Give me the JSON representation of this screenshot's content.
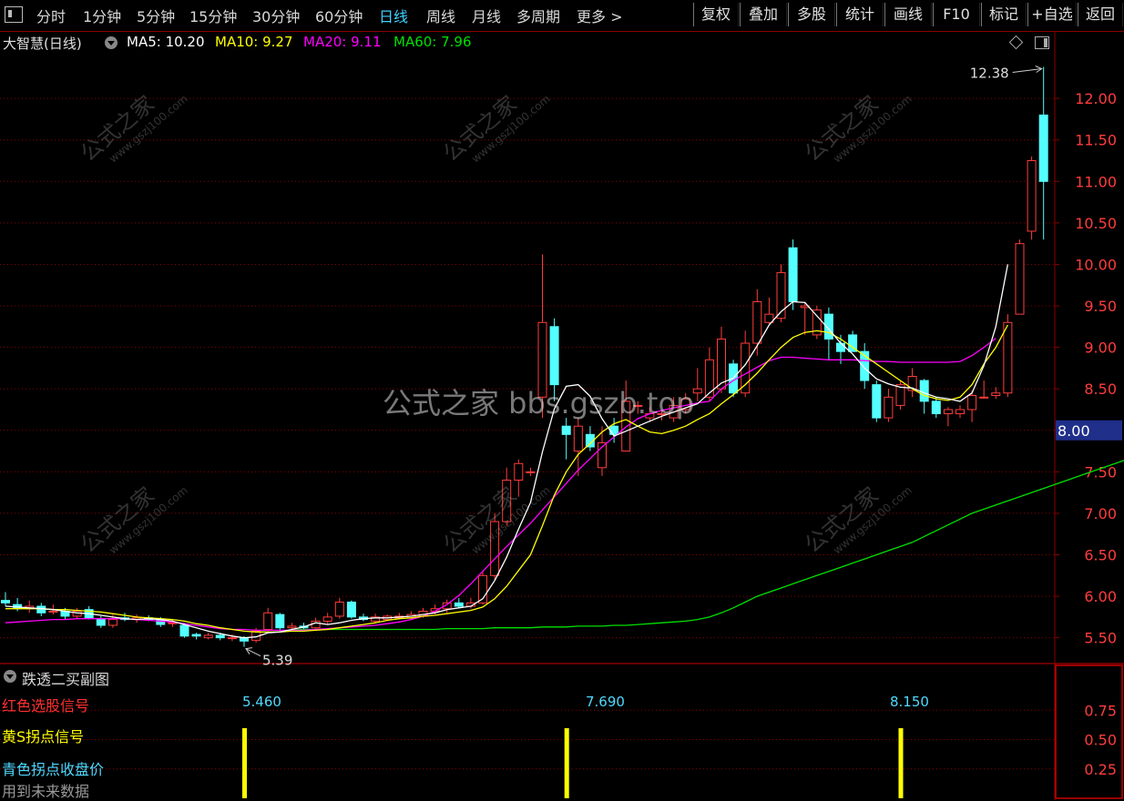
{
  "toolbar": {
    "tabs": [
      "分时",
      "1分钟",
      "5分钟",
      "15分钟",
      "30分钟",
      "60分钟",
      "日线",
      "周线",
      "月线",
      "多周期",
      "更多 >"
    ],
    "active_tab": "日线",
    "buttons": [
      "复权",
      "叠加",
      "多股",
      "统计",
      "画线",
      "F10",
      "标记",
      "+自选",
      "返回"
    ]
  },
  "header": {
    "stock_name": "大智慧(日线)",
    "ma5": "MA5: 10.20",
    "ma10": "MA10: 9.27",
    "ma20": "MA20: 9.11",
    "ma60": "MA60: 7.96"
  },
  "colors": {
    "up": "#ff3c3c",
    "down": "#54ffff",
    "ma5": "#ffffff",
    "ma10": "#ffff00",
    "ma20": "#ff00ff",
    "ma60": "#00e000",
    "grid": "#8b0000"
  },
  "annotations": {
    "high_label": "12.38",
    "low_label": "5.39",
    "current_price": "8.00"
  },
  "watermark": {
    "main": "公式之家 bbs.gszb.top",
    "diagonal": "公式之家",
    "diagonal_url": "www.gszj100.com"
  },
  "sub_panel": {
    "title": "跌透二买副图",
    "labels": [
      "红色选股信号",
      "黄S拐点信号",
      "青色拐点收盘价",
      "用到未来数据"
    ],
    "signal_values": [
      "5.460",
      "7.690",
      "8.150"
    ],
    "signal_prices": [
      5.46,
      7.69,
      8.15
    ]
  },
  "chart_data": [
    {
      "type": "candlestick",
      "title": "大智慧(日线)",
      "ylim": [
        5.2,
        12.55
      ],
      "y_ticks": [
        12.0,
        11.5,
        11.0,
        10.5,
        10.0,
        9.5,
        9.0,
        8.5,
        8.0,
        7.5,
        7.0,
        6.5,
        6.0,
        5.5
      ],
      "y_tick_labels": [
        "12.00",
        "11.50",
        "11.00",
        "10.50",
        "10.00",
        "9.50",
        "9.00",
        "8.50",
        "8.00",
        "7.50",
        "7.00",
        "6.50",
        "6.00",
        "5.50"
      ],
      "grid": true,
      "candles": [
        [
          5.95,
          5.92,
          6.05,
          5.88
        ],
        [
          5.9,
          5.85,
          5.98,
          5.82
        ],
        [
          5.85,
          5.88,
          5.95,
          5.8
        ],
        [
          5.88,
          5.8,
          5.92,
          5.76
        ],
        [
          5.82,
          5.82,
          5.9,
          5.78
        ],
        [
          5.82,
          5.76,
          5.86,
          5.72
        ],
        [
          5.76,
          5.82,
          5.86,
          5.73
        ],
        [
          5.84,
          5.74,
          5.88,
          5.72
        ],
        [
          5.72,
          5.65,
          5.76,
          5.62
        ],
        [
          5.65,
          5.72,
          5.78,
          5.62
        ],
        [
          5.74,
          5.72,
          5.8,
          5.7
        ],
        [
          5.72,
          5.74,
          5.78,
          5.68
        ],
        [
          5.74,
          5.72,
          5.77,
          5.7
        ],
        [
          5.72,
          5.66,
          5.75,
          5.63
        ],
        [
          5.68,
          5.68,
          5.72,
          5.63
        ],
        [
          5.65,
          5.52,
          5.68,
          5.5
        ],
        [
          5.54,
          5.52,
          5.56,
          5.48
        ],
        [
          5.5,
          5.53,
          5.56,
          5.48
        ],
        [
          5.53,
          5.5,
          5.56,
          5.47
        ],
        [
          5.5,
          5.5,
          5.54,
          5.46
        ],
        [
          5.5,
          5.46,
          5.52,
          5.39
        ],
        [
          5.47,
          5.58,
          5.62,
          5.44
        ],
        [
          5.6,
          5.8,
          5.86,
          5.58
        ],
        [
          5.78,
          5.62,
          5.8,
          5.58
        ],
        [
          5.62,
          5.64,
          5.68,
          5.58
        ],
        [
          5.64,
          5.62,
          5.68,
          5.6
        ],
        [
          5.62,
          5.7,
          5.74,
          5.6
        ],
        [
          5.7,
          5.75,
          5.8,
          5.66
        ],
        [
          5.76,
          5.93,
          5.98,
          5.73
        ],
        [
          5.93,
          5.75,
          5.95,
          5.73
        ],
        [
          5.75,
          5.72,
          5.79,
          5.7
        ],
        [
          5.7,
          5.75,
          5.79,
          5.68
        ],
        [
          5.72,
          5.76,
          5.78,
          5.7
        ],
        [
          5.74,
          5.76,
          5.8,
          5.72
        ],
        [
          5.74,
          5.78,
          5.82,
          5.72
        ],
        [
          5.76,
          5.82,
          5.86,
          5.74
        ],
        [
          5.82,
          5.85,
          5.9,
          5.78
        ],
        [
          5.85,
          5.92,
          5.96,
          5.8
        ],
        [
          5.92,
          5.88,
          5.98,
          5.86
        ],
        [
          5.88,
          5.92,
          5.98,
          5.85
        ],
        [
          5.92,
          6.25,
          6.3,
          5.9
        ],
        [
          6.25,
          6.9,
          7.0,
          6.2
        ],
        [
          6.9,
          7.4,
          7.55,
          6.85
        ],
        [
          7.4,
          7.6,
          7.65,
          7.2
        ],
        [
          7.5,
          7.5,
          7.55,
          7.45
        ],
        [
          8.4,
          9.3,
          10.12,
          8.15
        ],
        [
          9.25,
          8.55,
          9.35,
          8.35
        ],
        [
          8.05,
          7.95,
          8.15,
          7.65
        ],
        [
          7.75,
          8.05,
          8.15,
          7.45
        ],
        [
          7.95,
          7.8,
          8.05,
          7.75
        ],
        [
          7.55,
          7.85,
          8.05,
          7.45
        ],
        [
          8.05,
          7.95,
          8.15,
          7.85
        ],
        [
          7.75,
          8.35,
          8.6,
          7.75
        ],
        [
          8.3,
          8.3,
          8.35,
          8.2
        ],
        [
          8.15,
          8.2,
          8.28,
          8.1
        ],
        [
          8.2,
          8.2,
          8.24,
          8.12
        ],
        [
          8.15,
          8.3,
          8.4,
          8.1
        ],
        [
          8.25,
          8.38,
          8.45,
          8.2
        ],
        [
          8.45,
          8.5,
          8.75,
          8.35
        ],
        [
          8.4,
          8.85,
          9.0,
          8.35
        ],
        [
          8.5,
          9.1,
          9.25,
          8.45
        ],
        [
          8.8,
          8.45,
          8.85,
          8.4
        ],
        [
          8.45,
          9.05,
          9.2,
          8.4
        ],
        [
          9.05,
          9.55,
          9.7,
          8.9
        ],
        [
          9.3,
          9.4,
          9.6,
          9.28
        ],
        [
          9.35,
          9.9,
          10.0,
          9.3
        ],
        [
          10.2,
          9.55,
          10.3,
          9.45
        ],
        [
          9.48,
          9.5,
          9.55,
          9.15
        ],
        [
          9.15,
          9.45,
          9.5,
          9.1
        ],
        [
          9.4,
          9.1,
          9.48,
          8.85
        ],
        [
          9.05,
          8.95,
          9.15,
          8.8
        ],
        [
          9.15,
          8.95,
          9.2,
          8.95
        ],
        [
          8.95,
          8.6,
          9.05,
          8.5
        ],
        [
          8.55,
          8.15,
          8.6,
          8.1
        ],
        [
          8.15,
          8.4,
          8.5,
          8.1
        ],
        [
          8.3,
          8.55,
          8.6,
          8.25
        ],
        [
          8.48,
          8.65,
          8.75,
          8.4
        ],
        [
          8.6,
          8.35,
          8.62,
          8.2
        ],
        [
          8.35,
          8.2,
          8.4,
          8.15
        ],
        [
          8.2,
          8.25,
          8.28,
          8.05
        ],
        [
          8.2,
          8.25,
          8.3,
          8.15
        ],
        [
          8.25,
          8.42,
          8.48,
          8.1
        ],
        [
          8.4,
          8.4,
          8.6,
          8.38
        ],
        [
          8.42,
          8.45,
          8.52,
          8.38
        ],
        [
          8.45,
          9.3,
          9.4,
          8.4
        ],
        [
          9.4,
          10.25,
          10.3,
          9.4
        ],
        [
          10.4,
          11.25,
          11.3,
          10.3
        ],
        [
          11.8,
          11.0,
          12.38,
          10.3
        ]
      ],
      "ma5": [
        5.88,
        5.87,
        5.86,
        5.85,
        5.84,
        5.82,
        5.8,
        5.79,
        5.77,
        5.75,
        5.73,
        5.72,
        5.73,
        5.72,
        5.7,
        5.66,
        5.62,
        5.58,
        5.55,
        5.52,
        5.5,
        5.51,
        5.56,
        5.57,
        5.6,
        5.63,
        5.68,
        5.66,
        5.68,
        5.71,
        5.73,
        5.74,
        5.74,
        5.75,
        5.76,
        5.78,
        5.8,
        5.84,
        5.86,
        5.88,
        5.97,
        6.19,
        6.47,
        6.81,
        7.13,
        7.74,
        8.26,
        8.53,
        8.55,
        8.41,
        8.14,
        7.93,
        7.99,
        8.05,
        8.11,
        8.17,
        8.22,
        8.27,
        8.32,
        8.45,
        8.57,
        8.63,
        8.79,
        9.02,
        9.27,
        9.43,
        9.55,
        9.54,
        9.38,
        9.22,
        9.05,
        8.92,
        8.75,
        8.62,
        8.56,
        8.52,
        8.51,
        8.45,
        8.4,
        8.38,
        8.35,
        8.45,
        8.78,
        9.25,
        10.0
      ],
      "ma10": [
        5.85,
        5.85,
        5.85,
        5.85,
        5.84,
        5.84,
        5.83,
        5.82,
        5.81,
        5.79,
        5.77,
        5.75,
        5.74,
        5.73,
        5.72,
        5.7,
        5.67,
        5.65,
        5.62,
        5.6,
        5.58,
        5.57,
        5.57,
        5.57,
        5.58,
        5.58,
        5.59,
        5.6,
        5.62,
        5.64,
        5.66,
        5.68,
        5.71,
        5.73,
        5.74,
        5.76,
        5.77,
        5.79,
        5.81,
        5.83,
        5.87,
        5.97,
        6.12,
        6.31,
        6.5,
        6.85,
        7.22,
        7.5,
        7.71,
        7.84,
        7.98,
        8.08,
        8.13,
        8.05,
        7.98,
        7.96,
        8.0,
        8.05,
        8.13,
        8.2,
        8.32,
        8.43,
        8.55,
        8.69,
        8.85,
        9.0,
        9.12,
        9.18,
        9.2,
        9.18,
        9.1,
        9.0,
        8.9,
        8.8,
        8.7,
        8.6,
        8.5,
        8.42,
        8.38,
        8.36,
        8.4,
        8.55,
        8.8,
        9.0,
        9.27
      ],
      "ma20": [
        5.68,
        5.69,
        5.7,
        5.71,
        5.72,
        5.72,
        5.73,
        5.73,
        5.73,
        5.73,
        5.73,
        5.72,
        5.71,
        5.7,
        5.69,
        5.67,
        5.65,
        5.63,
        5.61,
        5.6,
        5.6,
        5.59,
        5.59,
        5.59,
        5.59,
        5.59,
        5.6,
        5.61,
        5.62,
        5.63,
        5.64,
        5.65,
        5.67,
        5.69,
        5.72,
        5.76,
        5.82,
        5.9,
        6.01,
        6.15,
        6.3,
        6.45,
        6.6,
        6.74,
        6.88,
        7.04,
        7.2,
        7.36,
        7.52,
        7.66,
        7.8,
        7.92,
        8.04,
        8.14,
        8.2,
        8.24,
        8.27,
        8.3,
        8.33,
        8.35,
        8.5,
        8.6,
        8.68,
        8.76,
        8.84,
        8.88,
        8.88,
        8.87,
        8.86,
        8.85,
        8.85,
        8.85,
        8.84,
        8.83,
        8.83,
        8.82,
        8.82,
        8.82,
        8.82,
        8.82,
        8.83,
        8.9,
        9.0,
        9.11
      ],
      "ma60": [
        5.6,
        5.6,
        5.6,
        5.6,
        5.6,
        5.6,
        5.6,
        5.6,
        5.6,
        5.6,
        5.6,
        5.6,
        5.6,
        5.61,
        5.61,
        5.61,
        5.61,
        5.62,
        5.62,
        5.62,
        5.62,
        5.63,
        5.63,
        5.63,
        5.64,
        5.64,
        5.64,
        5.65,
        5.65,
        5.66,
        5.67,
        5.68,
        5.69,
        5.7,
        5.72,
        5.75,
        5.8,
        5.86,
        5.93,
        6.0,
        6.05,
        6.1,
        6.15,
        6.2,
        6.25,
        6.3,
        6.35,
        6.4,
        6.45,
        6.5,
        6.55,
        6.6,
        6.65,
        6.72,
        6.79,
        6.86,
        6.93,
        7.0,
        7.05,
        7.1,
        7.15,
        7.2,
        7.25,
        7.3,
        7.35,
        7.4,
        7.45,
        7.5,
        7.55,
        7.6,
        7.65,
        7.7,
        7.75,
        7.8,
        7.85,
        7.9,
        7.95
      ],
      "ma60_start_index": 24
    },
    {
      "type": "bar",
      "title": "跌透二买副图",
      "ylim": [
        0,
        1.0
      ],
      "y_ticks": [
        0.75,
        0.5,
        0.25
      ],
      "y_tick_labels": [
        "0.75",
        "0.50",
        "0.25"
      ],
      "signal_indices": [
        20,
        47,
        75
      ],
      "values": [
        1,
        1,
        1
      ]
    }
  ]
}
